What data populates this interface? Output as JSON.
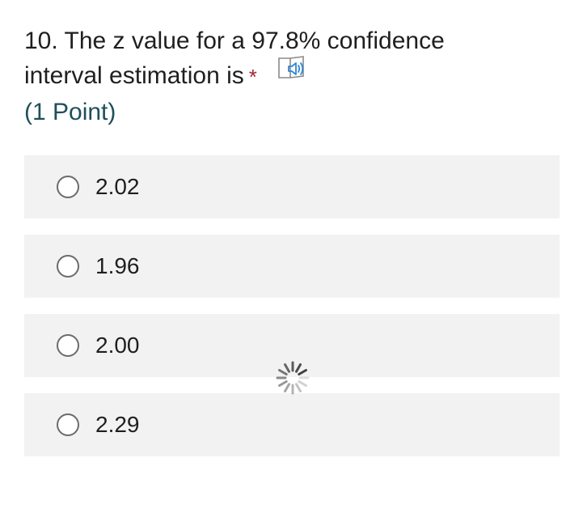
{
  "question": {
    "line1": "10. The z value for a 97.8% confidence",
    "line2": "interval estimation is",
    "required_mark": "*",
    "points": "(1 Point)"
  },
  "options": [
    {
      "label": "2.02"
    },
    {
      "label": "1.96"
    },
    {
      "label": "2.00"
    },
    {
      "label": "2.29"
    }
  ],
  "icons": {
    "reader": "immersive-reader-icon",
    "loading": "loading-spinner-icon"
  },
  "colors": {
    "required": "#a4262c",
    "points": "#1f4f5a",
    "option_bg": "#f2f2f2",
    "reader_icon": "#2b88d8"
  }
}
